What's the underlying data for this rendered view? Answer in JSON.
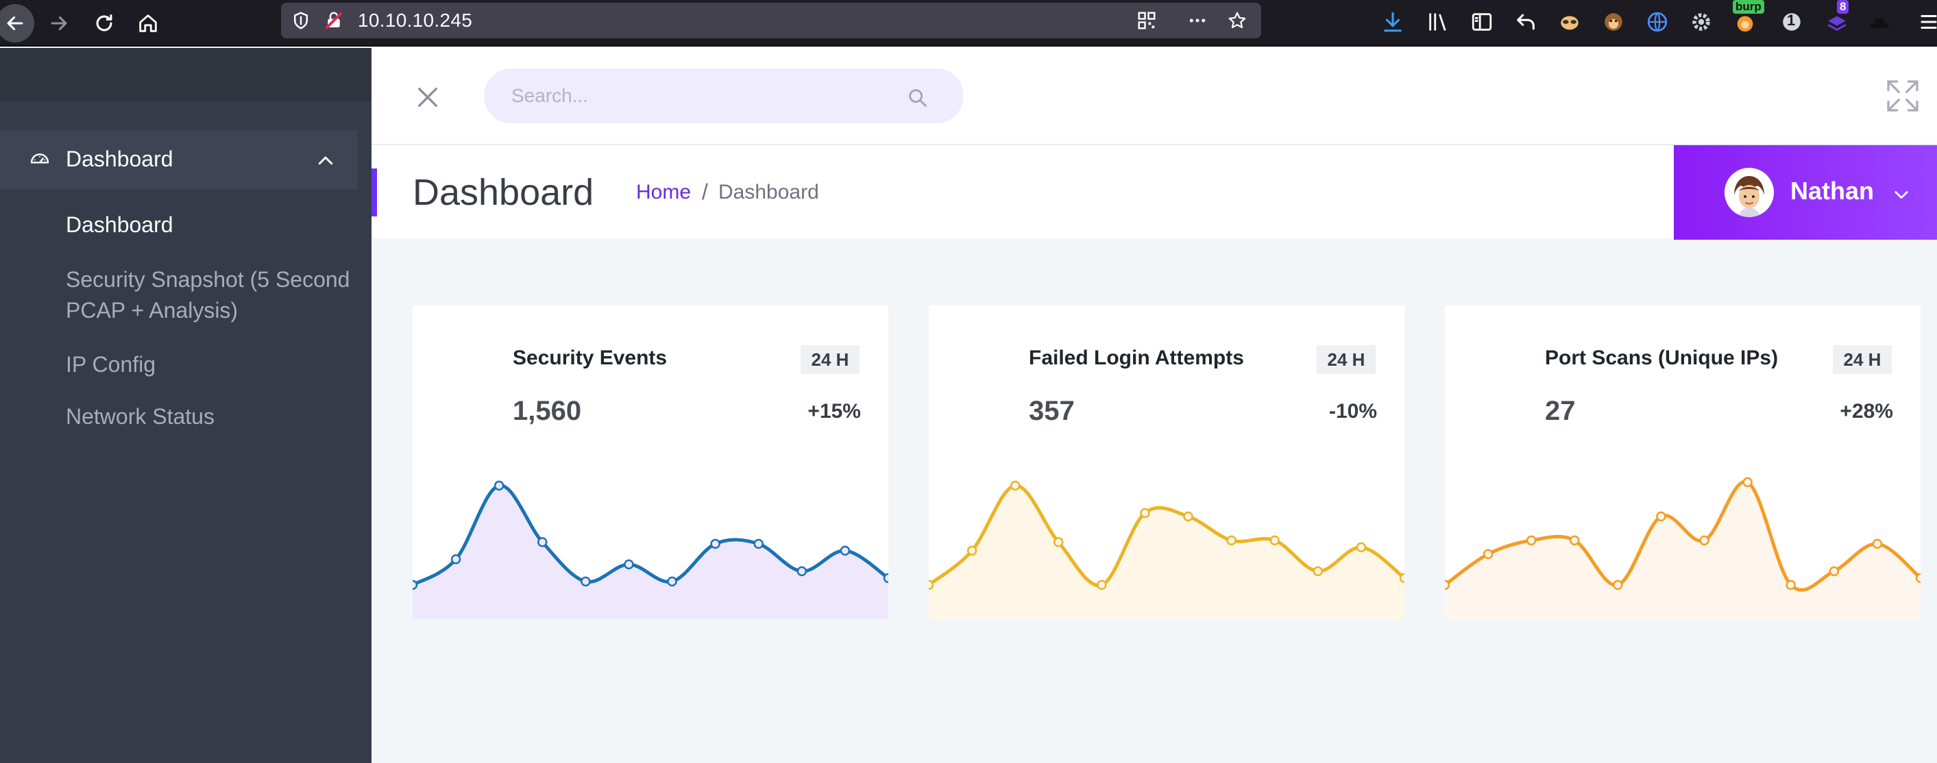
{
  "browser": {
    "url": "10.10.10.245",
    "ext_badge_burp": "burp",
    "ext_badge_one": "1",
    "ext_badge_eight": "8"
  },
  "sidebar": {
    "main_item": {
      "label": "Dashboard",
      "icon": "dashboard-gauge-icon"
    },
    "sub_items": [
      {
        "label": "Dashboard",
        "active": true
      },
      {
        "label": "Security Snapshot (5 Second PCAP + Analysis)",
        "active": false
      },
      {
        "label": "IP Config",
        "active": false
      },
      {
        "label": "Network Status",
        "active": false
      }
    ]
  },
  "header": {
    "search_placeholder": "Search...",
    "page_title": "Dashboard",
    "breadcrumb": {
      "home": "Home",
      "separator": "/",
      "current": "Dashboard"
    },
    "user": {
      "name": "Nathan"
    }
  },
  "cards": [
    {
      "title": "Security Events",
      "badge": "24 H",
      "value": "1,560",
      "change": "+15%",
      "color": "#1a73b5",
      "fill": "#efe8fd"
    },
    {
      "title": "Failed Login Attempts",
      "badge": "24 H",
      "value": "357",
      "change": "-10%",
      "color": "#ecb424",
      "fill": "#fef6e6"
    },
    {
      "title": "Port Scans (Unique IPs)",
      "badge": "24 H",
      "value": "27",
      "change": "+28%",
      "color": "#f49d25",
      "fill": "#fef6ec"
    }
  ],
  "chart_data": [
    {
      "type": "area",
      "title": "",
      "values": [
        20,
        35,
        78,
        45,
        22,
        32,
        22,
        44,
        44,
        28,
        40,
        24
      ]
    },
    {
      "type": "area",
      "title": "",
      "values": [
        20,
        40,
        78,
        45,
        20,
        62,
        60,
        46,
        46,
        28,
        42,
        24
      ]
    },
    {
      "type": "area",
      "title": "",
      "values": [
        20,
        38,
        46,
        46,
        20,
        60,
        46,
        80,
        20,
        28,
        44,
        24
      ]
    }
  ]
}
